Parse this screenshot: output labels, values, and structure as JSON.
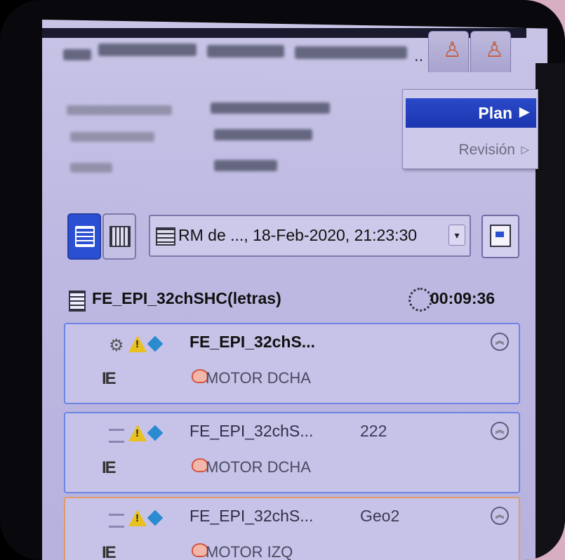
{
  "header": {
    "dots": "..",
    "tabs": [
      {
        "icon": "person-icon"
      },
      {
        "icon": "person-icon"
      }
    ]
  },
  "context_menu": {
    "items": [
      {
        "label": "Plan",
        "arrow": "▶",
        "selected": true
      },
      {
        "label": "Revisión",
        "arrow": "▷",
        "selected": false
      }
    ]
  },
  "toolbar": {
    "list_view": {
      "icon": "list-view-icon",
      "selected": true
    },
    "grid_view": {
      "icon": "calendar-grid-icon",
      "selected": false
    },
    "exam_dropdown": {
      "value": "RM de ..., 18-Feb-2020, 21:23:30",
      "arrow": "▾"
    },
    "export": {
      "icon": "export-icon"
    }
  },
  "protocol": {
    "name": "FE_EPI_32chSHC(letras)",
    "duration": "00:09:36"
  },
  "steps": [
    {
      "name": "FE_EPI_32chS...",
      "column": "",
      "coil": "MOTOR DCHA",
      "active": true,
      "border": "#6d84e4"
    },
    {
      "name": "FE_EPI_32chS...",
      "column": "222",
      "coil": "MOTOR DCHA",
      "active": false,
      "border": "#6d84e4"
    },
    {
      "name": "FE_EPI_32chS...",
      "column": "Geo2",
      "coil": "MOTOR IZQ",
      "active": false,
      "border": "#e09b6a"
    }
  ],
  "colors": {
    "accent": "#2b4fd3",
    "panel": "#c8c4e6",
    "warning": "#e8c11e",
    "pink_background": "#d8aec3"
  }
}
